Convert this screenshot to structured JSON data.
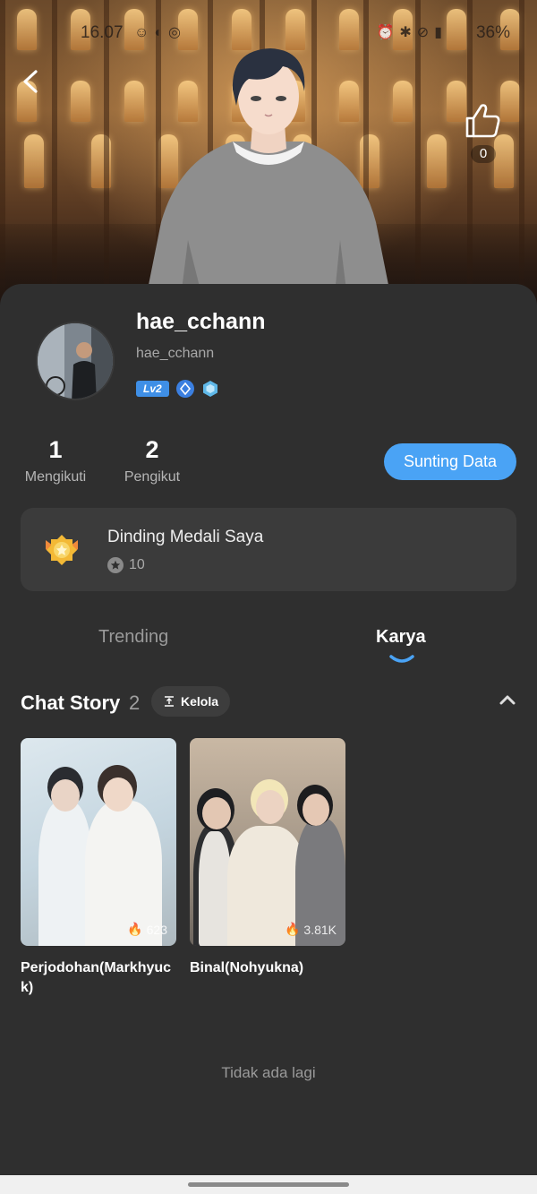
{
  "status_bar": {
    "time": "16.07",
    "battery": "36%"
  },
  "header": {
    "like_count": "0"
  },
  "profile": {
    "username": "hae_cchann",
    "handle": "hae_cchann",
    "level": "Lv2"
  },
  "stats": {
    "following_count": "1",
    "following_label": "Mengikuti",
    "followers_count": "2",
    "followers_label": "Pengikut"
  },
  "edit_button": "Sunting Data",
  "medal_wall": {
    "title": "Dinding Medali Saya",
    "count": "10"
  },
  "tabs": [
    {
      "label": "Trending",
      "active": false
    },
    {
      "label": "Karya",
      "active": true
    }
  ],
  "section": {
    "title": "Chat Story",
    "count": "2",
    "manage_label": "Kelola"
  },
  "stories": [
    {
      "title": "Perjodohan(Markhyuck)",
      "views": "623"
    },
    {
      "title": "Binal(Nohyukna)",
      "views": "3.81K"
    }
  ],
  "footer_text": "Tidak ada lagi",
  "colors": {
    "accent": "#4aa3f5",
    "background": "#2f2f2f",
    "card": "#3b3b3b"
  }
}
